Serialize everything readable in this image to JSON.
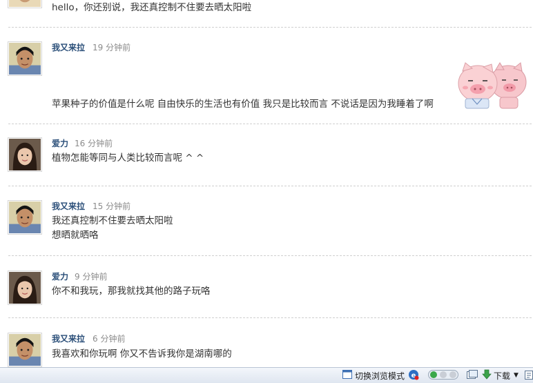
{
  "posts": [
    {
      "author": "",
      "time": "",
      "text": "hello，你还别说，我还真控制不住要去晒太阳啦",
      "text2": ""
    },
    {
      "author": "我又来拉",
      "time": "19 分钟前",
      "text": "苹果种子的价值是什么呢  自由快乐的生活也有价值  我只是比较而言  不说话是因为我睡着了啊",
      "text2": ""
    },
    {
      "author": "爱力",
      "time": "16 分钟前",
      "text": "植物怎能等同与人类比较而言呢 ^ ^",
      "text2": ""
    },
    {
      "author": "我又来拉",
      "time": "15 分钟前",
      "text": "我还真控制不住要去晒太阳啦",
      "text2": "想晒就晒咯"
    },
    {
      "author": "爱力",
      "time": "9 分钟前",
      "text": "你不和我玩，那我就找其他的路子玩咯",
      "text2": ""
    },
    {
      "author": "我又来拉",
      "time": "6 分钟前",
      "text": "我喜欢和你玩啊  你又不告诉我你是湖南哪的",
      "text2": ""
    }
  ],
  "statusbar": {
    "browse_mode_label": "切换浏览模式",
    "download_label": "下载"
  },
  "icons": {
    "browse_mode": "window-icon",
    "ie": "ie-icon",
    "toggle": "toggle-dots-icon",
    "gallery": "gallery-icon",
    "download": "download-arrow-icon",
    "extra": "clipboard-icon"
  },
  "colors": {
    "author": "#2b4f79",
    "time": "#8b8b8b",
    "message": "#333333",
    "separator": "#cfcfcf",
    "statusbar_bg": "#e6ecf4"
  }
}
